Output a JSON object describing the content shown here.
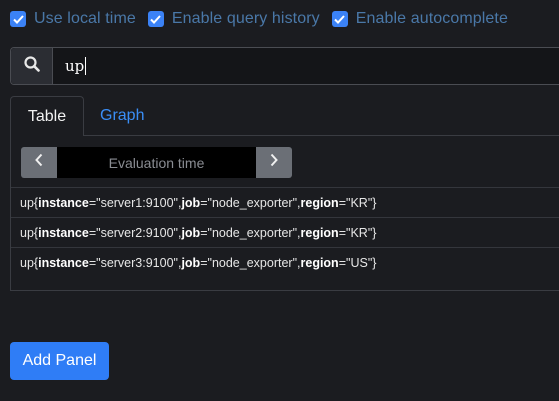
{
  "options": [
    {
      "label": "Use local time",
      "checked": true
    },
    {
      "label": "Enable query history",
      "checked": true
    },
    {
      "label": "Enable autocomplete",
      "checked": true
    }
  ],
  "query": {
    "value": "up",
    "icon": "search-icon"
  },
  "tabs": [
    {
      "label": "Table",
      "active": true
    },
    {
      "label": "Graph",
      "active": false
    }
  ],
  "eval": {
    "placeholder": "Evaluation time",
    "prev_icon": "chevron-left-icon",
    "next_icon": "chevron-right-icon"
  },
  "results": [
    {
      "metric": "up",
      "labels": [
        {
          "k": "instance",
          "v": "server1:9100"
        },
        {
          "k": "job",
          "v": "node_exporter"
        },
        {
          "k": "region",
          "v": "KR"
        }
      ]
    },
    {
      "metric": "up",
      "labels": [
        {
          "k": "instance",
          "v": "server2:9100"
        },
        {
          "k": "job",
          "v": "node_exporter"
        },
        {
          "k": "region",
          "v": "KR"
        }
      ]
    },
    {
      "metric": "up",
      "labels": [
        {
          "k": "instance",
          "v": "server3:9100"
        },
        {
          "k": "job",
          "v": "node_exporter"
        },
        {
          "k": "region",
          "v": "US"
        }
      ]
    }
  ],
  "add_panel_label": "Add Panel",
  "colors": {
    "accent": "#2f7df6",
    "checkbox": "#3b82f6",
    "background": "#1b1c20"
  }
}
